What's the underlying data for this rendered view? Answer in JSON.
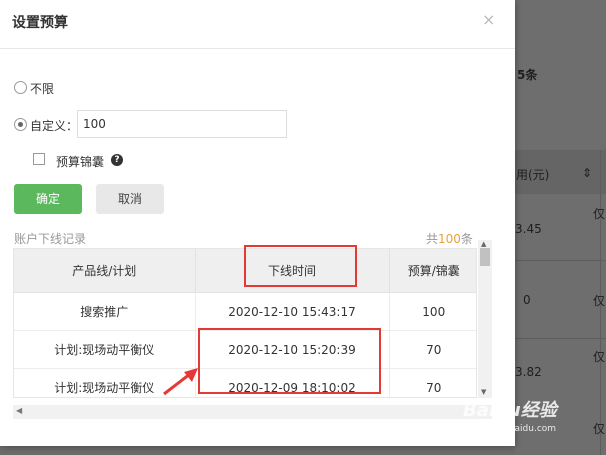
{
  "background": {
    "count_text": "5条",
    "column_header": "用(元)",
    "cells": [
      "3.45",
      "仅",
      "0",
      "仅",
      "3.82",
      "仅",
      "仅"
    ]
  },
  "dialog": {
    "title": "设置预算",
    "close_glyph": "×",
    "options": {
      "unlimited_label": "不限",
      "custom_label": "自定义：",
      "custom_value": "100",
      "selected": "custom"
    },
    "budget_brocade_label": "预算锦囊",
    "help_glyph": "?",
    "buttons": {
      "confirm": "确定",
      "cancel": "取消"
    },
    "records": {
      "title": "账户下线记录",
      "count_prefix": "共",
      "count_value": "100",
      "count_suffix": "条",
      "columns": [
        "产品线/计划",
        "下线时间",
        "预算/锦囊"
      ],
      "rows": [
        [
          "搜索推广",
          "2020-12-10 15:43:17",
          "100"
        ],
        [
          "计划:现场动平衡仪",
          "2020-12-10 15:20:39",
          "70"
        ],
        [
          "计划:现场动平衡仪",
          "2020-12-09 18:10:02",
          "70"
        ]
      ]
    }
  },
  "watermark": {
    "logo": "Baidu经验",
    "site": "jingyan.baidu.com"
  },
  "colors": {
    "confirm": "#5cb85c",
    "highlight": "#e53935",
    "count": "#e6a23c"
  }
}
